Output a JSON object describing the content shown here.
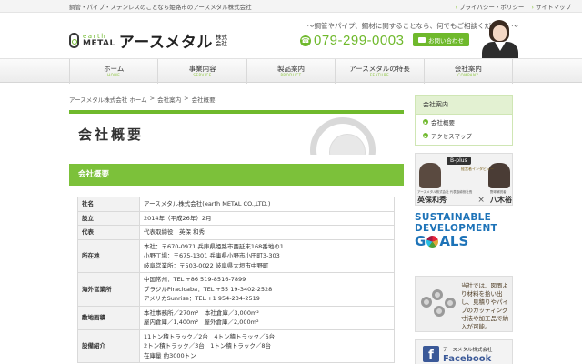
{
  "topbar": {
    "tagline": "鋼管・パイプ・ステンレスのことなら姫路市のアースメタル株式会社",
    "links": [
      "プライバシー・ポリシー",
      "サイトマップ"
    ]
  },
  "header": {
    "logo_en_top": "earth",
    "logo_en_bottom": "METAL",
    "logo_jp": "アースメタル",
    "logo_kk": "株式会社",
    "catch": "～鋼管やパイプ、鋼材に関することなら、何でもご相談ください。～",
    "phone": "079-299-0003",
    "contact_button": "お問い合わせ"
  },
  "nav": [
    {
      "jp": "ホーム",
      "en": "HOME"
    },
    {
      "jp": "事業内容",
      "en": "SERVICE"
    },
    {
      "jp": "製品案内",
      "en": "PRODUCT"
    },
    {
      "jp": "アースメタルの特長",
      "en": "FEATURE"
    },
    {
      "jp": "会社案内",
      "en": "COMPANY"
    }
  ],
  "breadcrumb": [
    "アースメタル株式会社 ホーム",
    ">",
    "会社案内",
    ">",
    "会社概要"
  ],
  "page_title": "会社概要",
  "section_heading": "会社概要",
  "profile": {
    "rows": [
      {
        "label": "社名",
        "lines": [
          "アースメタル株式会社(earth METAL CO.,LTD.)"
        ]
      },
      {
        "label": "設立",
        "lines": [
          "2014年（平成26年）2月"
        ]
      },
      {
        "label": "代表",
        "lines": [
          "代表取締役　英保 和秀"
        ]
      },
      {
        "label": "所在地",
        "lines": [
          "本社：〒670-0971 兵庫県姫路市西延末168番地の1",
          "小野工場：〒675-1301 兵庫県小野市小田町3-303",
          "岐阜営業所：〒503-0022 岐阜県大垣市中野町"
        ]
      },
      {
        "label": "海外営業所",
        "lines": [
          "中国常州：TEL +86 519-8516-7899",
          "ブラジルPiracicaba：TEL +55 19-3402-2528",
          "アメリカSunrise：TEL +1 954-234-2519"
        ]
      },
      {
        "label": "敷地面積",
        "lines": [
          "本社事務所／270m²　本社倉庫／3,000m²",
          "屋内倉庫／1,400m²　屋外倉庫／2,000m²"
        ]
      },
      {
        "label": "設備紹介",
        "lines": [
          "11トン積トラック／2台　4トン積トラック／6台",
          "2トン積トラック／3台　1トン積トラック／8台",
          "在庫量 約3000トン"
        ]
      }
    ]
  },
  "sidebar": {
    "title": "会社案内",
    "links": [
      "会社概要",
      "アクセスマップ"
    ]
  },
  "banners": {
    "bplus": {
      "logo": "B-plus",
      "sub": "経営者インタビュー",
      "left_role": "アースメタル株式会社 代表取締役社長",
      "left_name": "英保和秀",
      "x": "×",
      "right_role": "野球解説者",
      "right_name": "八木裕"
    },
    "sdgs": {
      "line1": "SUSTAINABLE",
      "line2": "DEVELOPMENT",
      "goals_a": "G",
      "goals_b": "ALS"
    },
    "cut": {
      "text": "当社では、図面より材料を拾い出し、見積りやパイプのカッティング寸法や加工品で納入が可能。"
    },
    "facebook": {
      "company": "アースメタル株式会社",
      "word": "Facebook"
    }
  },
  "colors": {
    "brand_green": "#6fb92c",
    "section_green": "#7cc13a",
    "facebook_blue": "#3b5998",
    "sdgs_blue": "#1d73b8"
  }
}
